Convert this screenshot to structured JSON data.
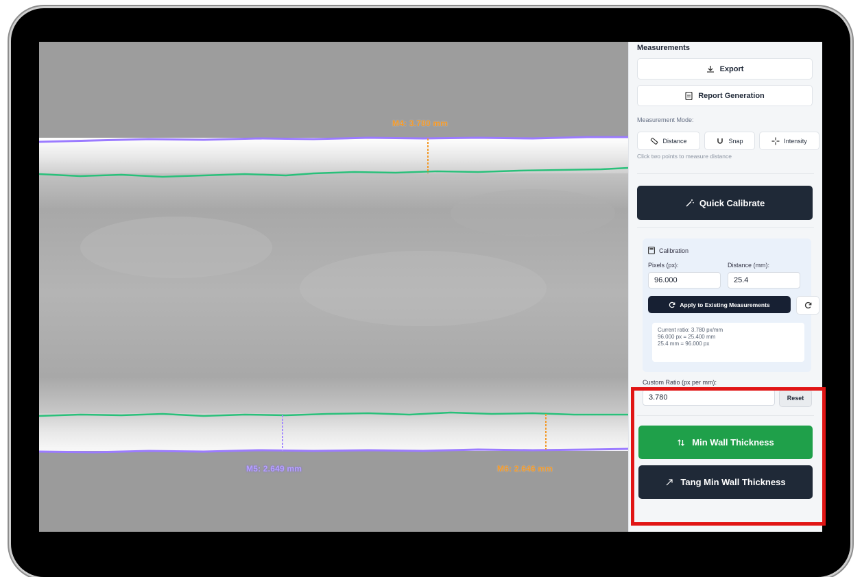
{
  "viewer": {
    "measurements": [
      {
        "id": "M4",
        "label": "M4: 3.780 mm",
        "color": "#f39a2a"
      },
      {
        "id": "M5",
        "label": "M5: 2.649 mm",
        "color": "#a58cff"
      },
      {
        "id": "M6",
        "label": "M6: 2.646 mm",
        "color": "#f39a2a"
      }
    ]
  },
  "panel": {
    "title": "Measurements",
    "export_label": "Export",
    "report_label": "Report Generation",
    "mode_label": "Measurement Mode:",
    "modes": [
      "Distance",
      "Snap",
      "Intensity"
    ],
    "hint": "Click two points to measure distance",
    "quick_calibrate_label": "Quick Calibrate",
    "calibration": {
      "title": "Calibration",
      "pixels_label": "Pixels (px):",
      "distance_label": "Distance (mm):",
      "pixels_value": "96.000",
      "distance_value": "25.4",
      "apply_label": "Apply to Existing Measurements",
      "info_lines": [
        "Current ratio: 3.780 px/mm",
        "96.000 px = 25.400 mm",
        "25.4 mm = 96.000 px"
      ]
    },
    "custom_ratio_label": "Custom Ratio (px per mm):",
    "custom_ratio_value": "3.780",
    "reset_label": "Reset",
    "min_wall_label": "Min Wall Thickness",
    "tang_min_wall_label": "Tang Min Wall Thickness"
  },
  "colors": {
    "accent_green": "#1fa04a",
    "dark_button": "#1f2937",
    "highlight_red": "#e11515",
    "edge_purple": "#9b7bff",
    "edge_green": "#29c07a"
  }
}
